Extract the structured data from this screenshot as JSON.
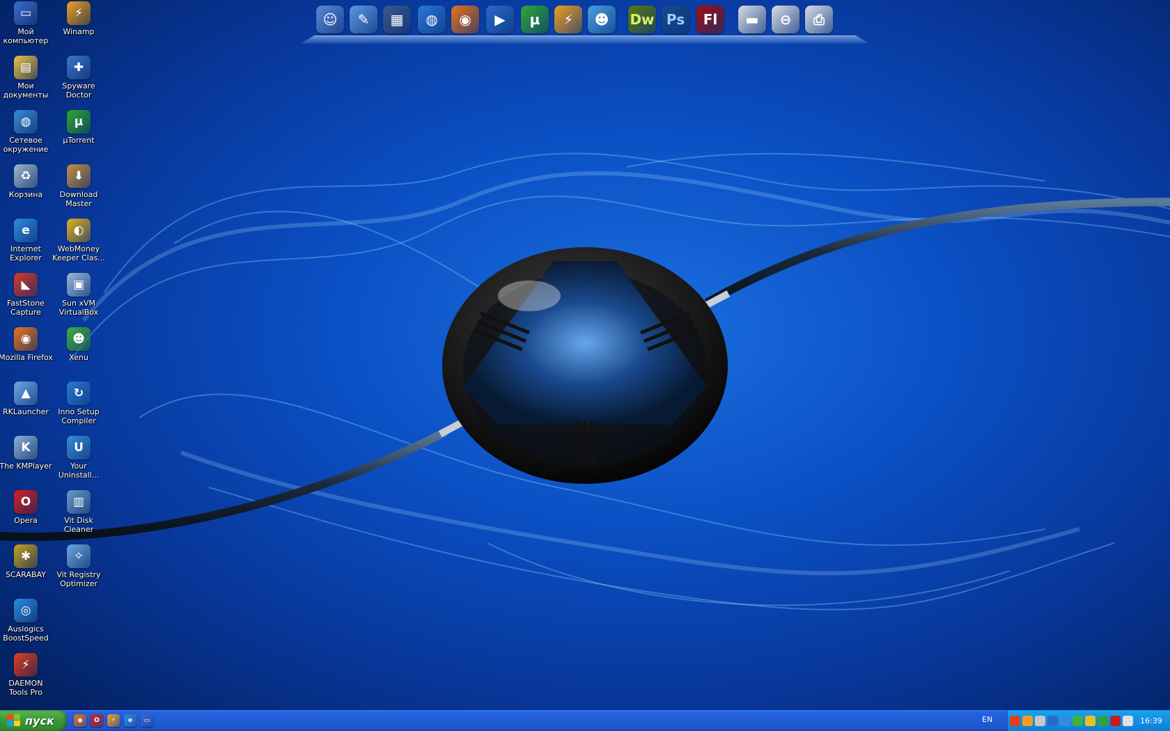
{
  "desktop": {
    "icons_col1": [
      {
        "label": "Мой компьютер",
        "icon": "my-computer-icon"
      },
      {
        "label": "Мои документы",
        "icon": "my-documents-icon"
      },
      {
        "label": "Сетевое окружение",
        "icon": "network-icon"
      },
      {
        "label": "Корзина",
        "icon": "recycle-bin-icon"
      },
      {
        "label": "Internet Explorer",
        "icon": "internet-explorer-icon"
      },
      {
        "label": "FastStone Capture",
        "icon": "faststone-capture-icon"
      },
      {
        "label": "Mozilla Firefox",
        "icon": "firefox-icon"
      },
      {
        "label": "RKLauncher",
        "icon": "rklauncher-icon"
      },
      {
        "label": "The KMPlayer",
        "icon": "kmplayer-icon"
      },
      {
        "label": "Opera",
        "icon": "opera-icon"
      },
      {
        "label": "SCARABAY",
        "icon": "scarabay-icon"
      },
      {
        "label": "Auslogics BoostSpeed",
        "icon": "boostspeed-icon"
      },
      {
        "label": "DAEMON Tools Pro",
        "icon": "daemon-tools-icon"
      }
    ],
    "icons_col2": [
      {
        "label": "Winamp",
        "icon": "winamp-icon"
      },
      {
        "label": "Spyware Doctor",
        "icon": "spyware-doctor-icon"
      },
      {
        "label": "µTorrent",
        "icon": "utorrent-icon"
      },
      {
        "label": "Download Master",
        "icon": "download-master-icon"
      },
      {
        "label": "WebMoney Keeper Clas...",
        "icon": "webmoney-icon"
      },
      {
        "label": "Sun xVM VirtualBox",
        "icon": "virtualbox-icon"
      },
      {
        "label": "Xenu",
        "icon": "xenu-icon"
      },
      {
        "label": "Inno Setup Compiler",
        "icon": "inno-setup-icon"
      },
      {
        "label": "Your Uninstall...",
        "icon": "your-uninstaller-icon"
      },
      {
        "label": "Vit Disk Cleaner",
        "icon": "vit-disk-cleaner-icon"
      },
      {
        "label": "Vit Registry Optimizer",
        "icon": "vit-registry-icon"
      }
    ]
  },
  "dock": {
    "items": [
      {
        "icon": "finder-icon"
      },
      {
        "icon": "pencil-ruler-icon"
      },
      {
        "icon": "dashboard-icon"
      },
      {
        "icon": "globe-icon"
      },
      {
        "icon": "firefox-icon"
      },
      {
        "icon": "media-player-icon"
      },
      {
        "icon": "utorrent-icon"
      },
      {
        "icon": "winamp-icon"
      },
      {
        "icon": "messenger-icon"
      },
      {
        "icon": "dreamweaver-icon",
        "text": "Dw"
      },
      {
        "icon": "photoshop-icon",
        "text": "Ps"
      },
      {
        "icon": "flash-icon",
        "text": "Fl"
      },
      {
        "icon": "drive-icon"
      },
      {
        "icon": "drive-removed-icon"
      },
      {
        "icon": "printer-drive-icon"
      }
    ]
  },
  "taskbar": {
    "start_label": "пуск",
    "quick_launch": [
      "firefox-icon",
      "opera-icon",
      "winamp-icon",
      "internet-explorer-icon",
      "desktop-icon"
    ],
    "language": "EN",
    "clock": "16:39",
    "tray_icons": [
      "tray-icon-1",
      "tray-icon-2",
      "tray-icon-3",
      "tray-icon-4",
      "tray-icon-5",
      "tray-icon-6",
      "tray-icon-7",
      "tray-icon-8",
      "tray-icon-9",
      "tray-icon-10"
    ]
  },
  "colors": {
    "wallpaper_blue": "#0b4fc4",
    "taskbar_blue": "#225cd8",
    "start_green": "#3c9a38",
    "tray_blue": "#1290e3"
  }
}
